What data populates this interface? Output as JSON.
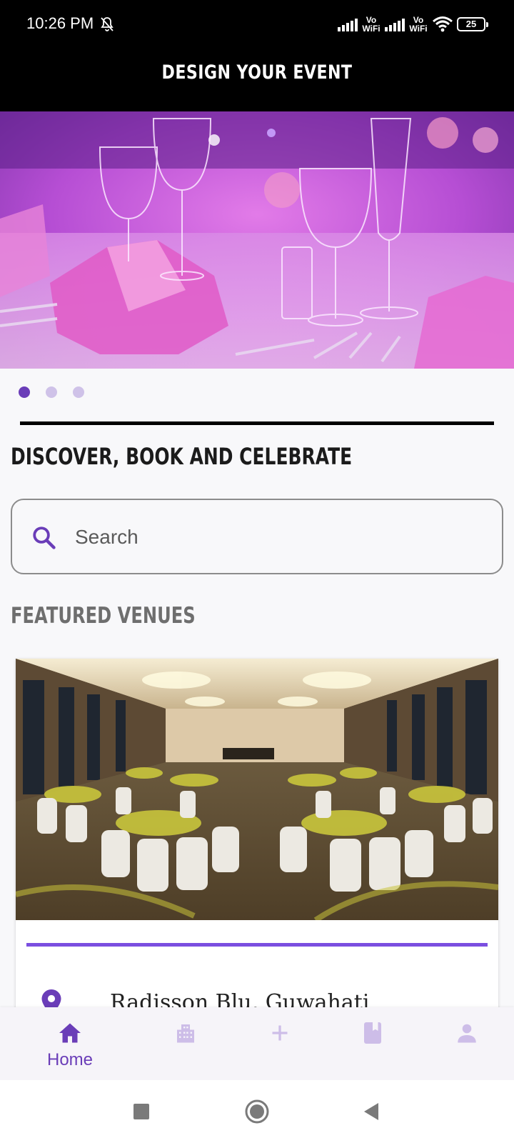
{
  "status_bar": {
    "time": "10:26 PM",
    "vowifi_1": "Vo\nWiFi",
    "vowifi_2": "Vo\nWiFi",
    "battery": "25"
  },
  "app_bar": {
    "title": "DESIGN YOUR EVENT"
  },
  "carousel": {
    "slide_count": 3,
    "active_index": 0
  },
  "main": {
    "heading": "DISCOVER, BOOK AND CELEBRATE",
    "search": {
      "placeholder": "Search"
    },
    "featured_title": "FEATURED VENUES",
    "venues": [
      {
        "name": "Radisson Blu, Guwahati"
      }
    ]
  },
  "bottom_nav": {
    "items": [
      {
        "label": "Home",
        "icon": "home-icon",
        "active": true
      },
      {
        "label": "",
        "icon": "venues-building-icon",
        "active": false
      },
      {
        "label": "",
        "icon": "add-icon",
        "active": false
      },
      {
        "label": "",
        "icon": "bookings-book-icon",
        "active": false
      },
      {
        "label": "",
        "icon": "profile-person-icon",
        "active": false
      }
    ]
  },
  "colors": {
    "accent": "#6a3db8",
    "accent_light": "#cfc2e8",
    "venue_accent": "#7b4fe0",
    "app_bar": "#000000"
  }
}
